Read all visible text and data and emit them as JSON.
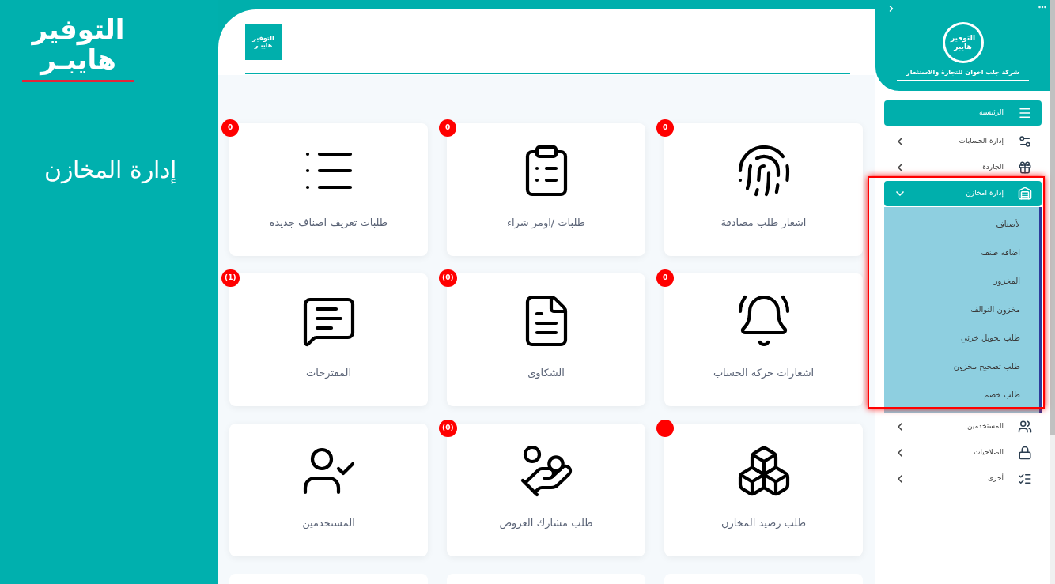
{
  "brand": {
    "logo_lines": [
      "التوفير",
      "هايبـر"
    ],
    "page_title": "إدارة المخازن"
  },
  "header": {
    "logo_lines": [
      "التوفير",
      "هايبـر"
    ]
  },
  "cards": [
    {
      "label": "اشعار طلب مصادقة",
      "badge": "0"
    },
    {
      "label": "طلبات /اومر شراء",
      "badge": "0"
    },
    {
      "label": "طلبات تعريف اصناف جديده",
      "badge": "0"
    },
    {
      "label": "اشعارات حركه الحساب",
      "badge": "0"
    },
    {
      "label": "الشكاوى",
      "badge": "(0)"
    },
    {
      "label": "المقترحات",
      "badge": "(1)"
    },
    {
      "label": "طلب رصيد المخازن",
      "alert_dot": true
    },
    {
      "label": "طلب مشارك العروض",
      "badge": "(0)"
    },
    {
      "label": "المستخدمين"
    }
  ],
  "sidebar": {
    "company": "شركة جلب اخوان للتجارة والاستثمار",
    "logo_lines": [
      "التوفير",
      "هايبر"
    ],
    "items": [
      {
        "label": "الرئيسية",
        "selected": true
      },
      {
        "label": "إدارة الحسابات",
        "selected": false
      },
      {
        "label": "الجاردة",
        "selected": false
      },
      {
        "label": "إدارة امخازن",
        "selected": true,
        "expanded": true,
        "children": [
          {
            "label": "لأصناف"
          },
          {
            "label": "اضافه صنف"
          },
          {
            "label": "المخزون"
          },
          {
            "label": "مخزون التوالف"
          },
          {
            "label": "طلب تحويل خزئي"
          },
          {
            "label": "طلب تصحيح مخزون"
          },
          {
            "label": "طلب خصم"
          }
        ]
      },
      {
        "label": "المستخدمين",
        "selected": false
      },
      {
        "label": "الصلاحيات",
        "selected": false
      },
      {
        "label": "أخرى",
        "selected": false
      }
    ]
  }
}
